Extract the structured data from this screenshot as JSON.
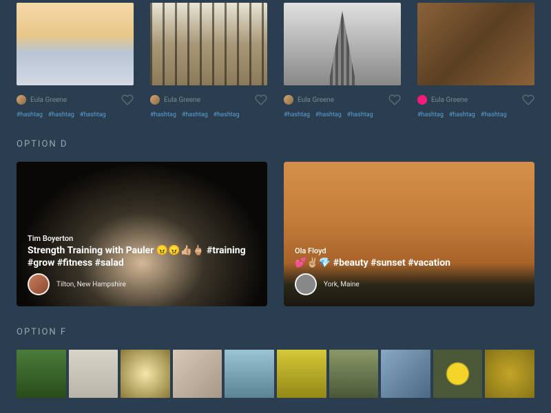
{
  "rowSmall": [
    {
      "author": "Eula Greene",
      "tags": [
        "#hashtag",
        "#hashtag",
        "#hashtag"
      ],
      "avatar": "av1"
    },
    {
      "author": "Eula Greene",
      "tags": [
        "#hashtag",
        "#hashtag",
        "#hashtag"
      ],
      "avatar": "av1"
    },
    {
      "author": "Eula Greene",
      "tags": [
        "#hashtag",
        "#hashtag",
        "#hashtag"
      ],
      "avatar": "av1"
    },
    {
      "author": "Eula Greene",
      "tags": [
        "#hashtag",
        "#hashtag",
        "#hashtag"
      ],
      "avatar": "av2"
    }
  ],
  "sections": {
    "d": "OPTION D",
    "f": "OPTION F"
  },
  "rowLarge": [
    {
      "author": "Tim Boyerton",
      "caption": "Strength Training with Pauler 😠😠👍🏼🖕🏼 #training #grow #fitness #salad",
      "location": "Tilton, New Hampshire"
    },
    {
      "author": "Ola Floyd",
      "caption": "💕✌🏼💎   #beauty #sunset #vacation",
      "location": "York, Maine"
    }
  ]
}
